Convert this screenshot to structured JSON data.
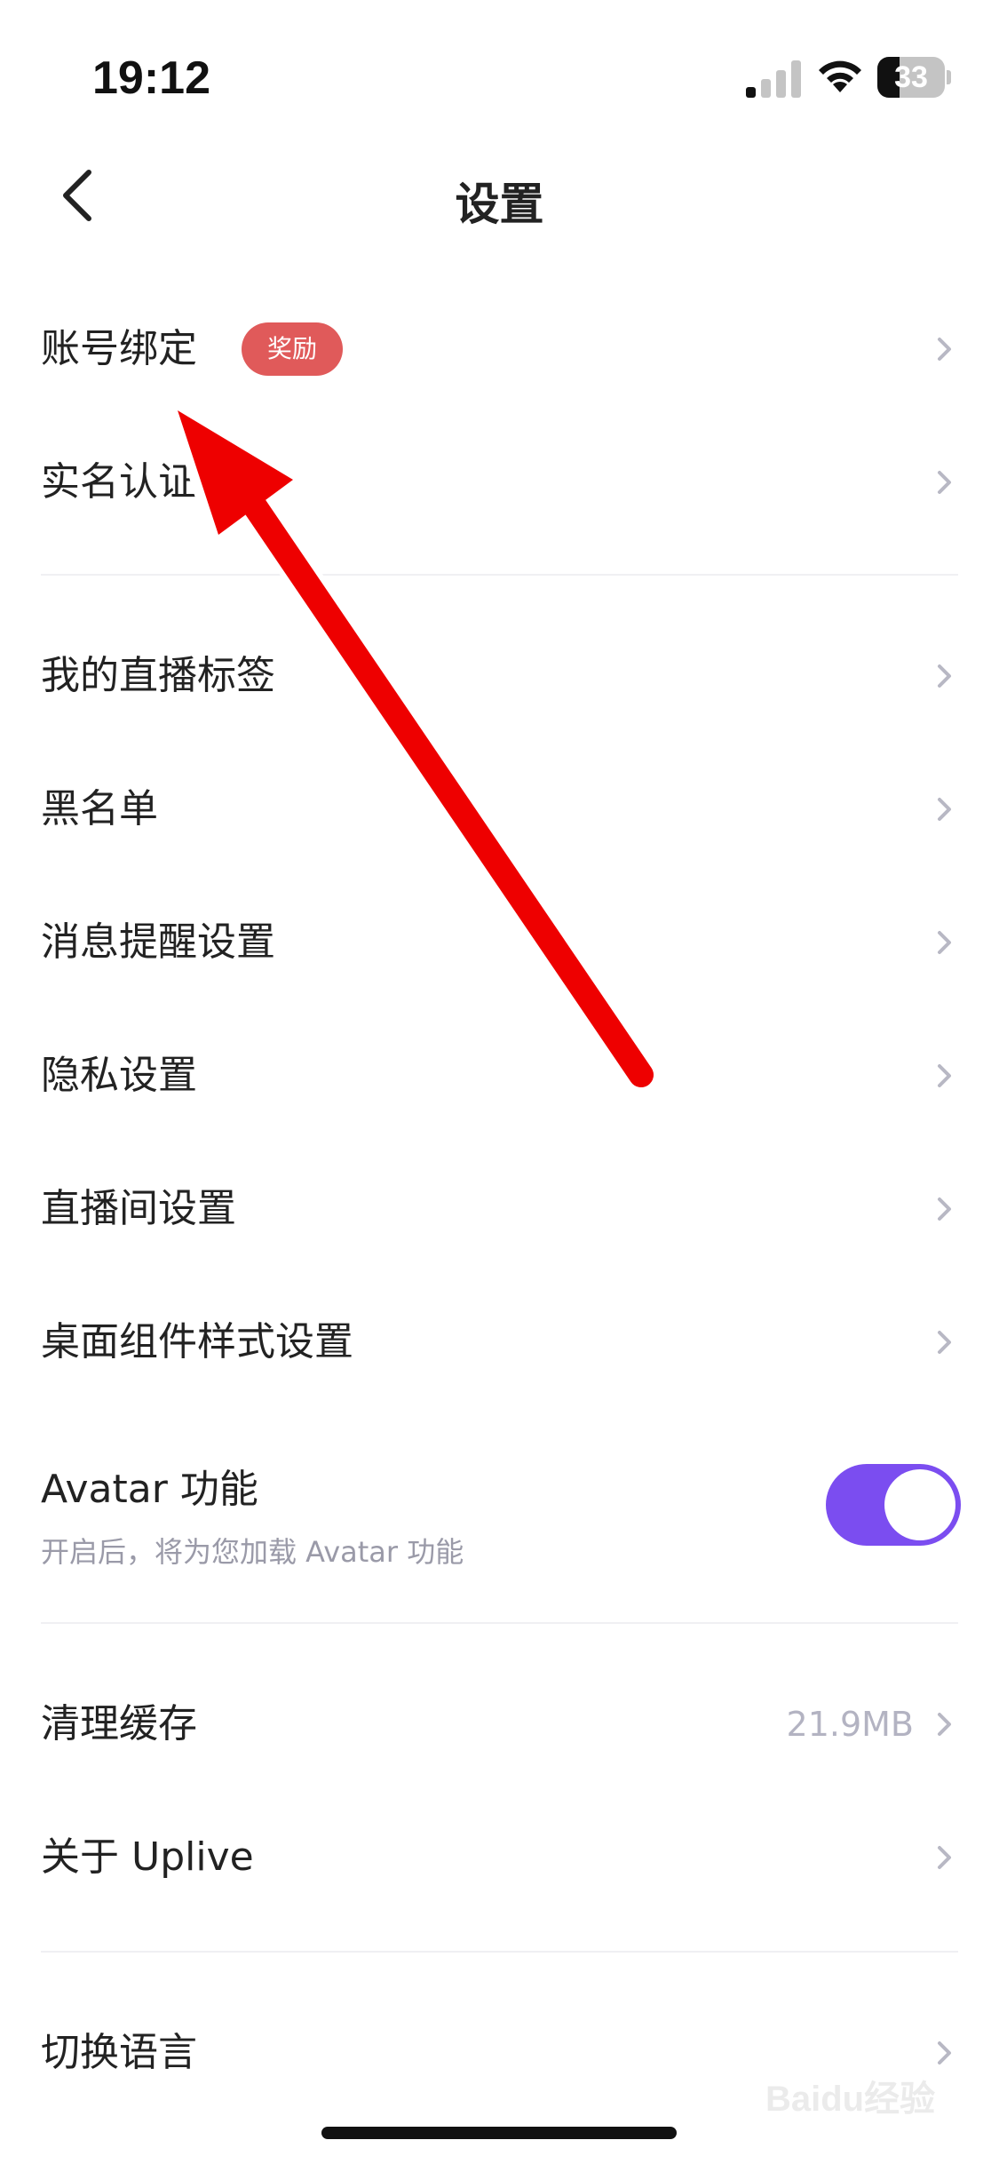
{
  "status_bar": {
    "time": "19:12",
    "battery": "33",
    "battery_level": 0.33
  },
  "nav": {
    "title": "设置"
  },
  "section1": [
    {
      "label": "账号绑定",
      "badge": "奖励"
    },
    {
      "label": "实名认证"
    }
  ],
  "section2": [
    {
      "label": "我的直播标签"
    },
    {
      "label": "黑名单"
    },
    {
      "label": "消息提醒设置"
    },
    {
      "label": "隐私设置"
    },
    {
      "label": "直播间设置"
    },
    {
      "label": "桌面组件样式设置"
    }
  ],
  "avatar": {
    "title": "Avatar 功能",
    "subtitle": "开启后，将为您加载 Avatar 功能",
    "enabled": true
  },
  "section3": [
    {
      "label": "清理缓存",
      "value": "21.9MB"
    },
    {
      "label": "关于 Uplive"
    }
  ],
  "section4": [
    {
      "label": "切换语言"
    }
  ],
  "colors": {
    "accent": "#7b4df0",
    "badge": "#e05a5a",
    "annotation": "#ee0000"
  },
  "watermark": "Baidu经验"
}
